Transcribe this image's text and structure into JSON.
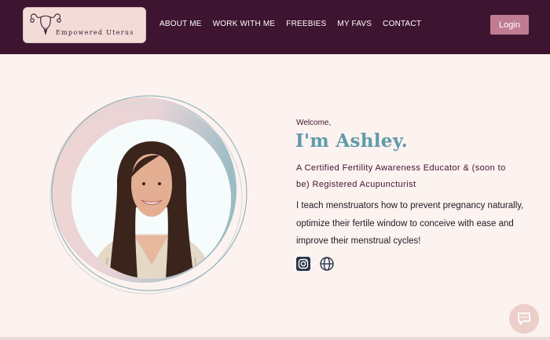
{
  "brand": {
    "name": "Empowered Uterus"
  },
  "nav": {
    "items": [
      {
        "label": "ABOUT ME"
      },
      {
        "label": "WORK WITH ME"
      },
      {
        "label": "FREEBIES"
      },
      {
        "label": "MY FAVS"
      },
      {
        "label": "CONTACT"
      }
    ]
  },
  "header": {
    "login_label": "Login"
  },
  "hero": {
    "welcome": "Welcome,",
    "title": "I'm Ashley.",
    "subtitle": "A Certified Fertility Awareness Educator & (soon to be) Registered Acupuncturist",
    "intro": "I teach menstruators how to prevent pregnancy naturally, optimize their fertile window to conceive with ease and improve their menstrual cycles!"
  },
  "social": [
    {
      "icon": "instagram-icon"
    },
    {
      "icon": "globe-icon"
    }
  ],
  "chat": {
    "icon": "chat-icon"
  },
  "colors": {
    "header_bg": "#3e1530",
    "accent": "#c07d92",
    "title": "#5e9bab",
    "page_bg": "#fcf2ef"
  }
}
